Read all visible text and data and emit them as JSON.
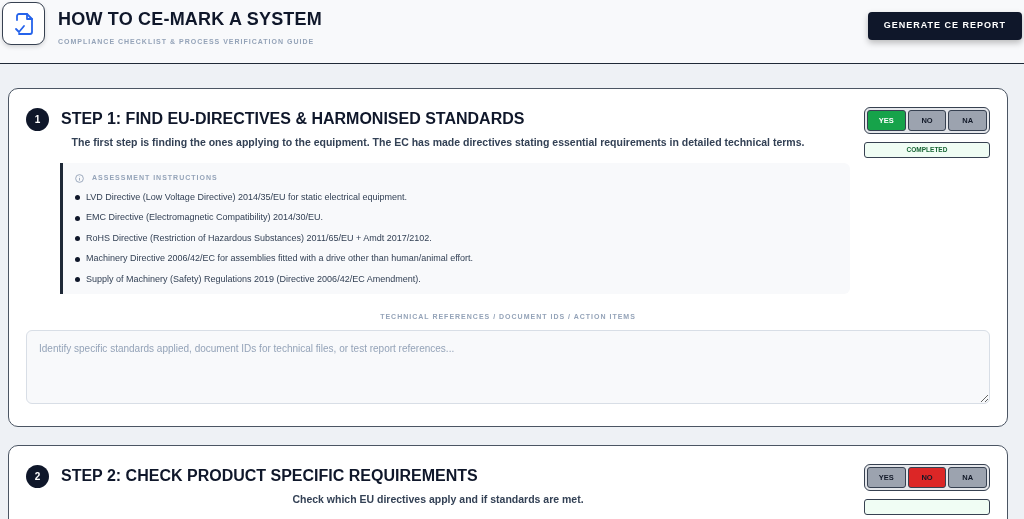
{
  "header": {
    "title": "HOW TO CE-MARK A SYSTEM",
    "subtitle": "COMPLIANCE CHECKLIST & PROCESS VERIFICATION GUIDE",
    "action": "GENERATE CE REPORT"
  },
  "steps": [
    {
      "number": "1",
      "title": "STEP 1: FIND EU-DIRECTIVES & HARMONISED STANDARDS",
      "description": "The first step is finding the ones applying to the equipment. The EC has made directives stating essential requirements in detailed technical terms.",
      "choices": [
        {
          "label": "YES",
          "selected": true
        },
        {
          "label": "NO",
          "selected": false
        },
        {
          "label": "NA",
          "selected": false
        }
      ],
      "status": {
        "label": "COMPLETED",
        "kind": "completed"
      },
      "instructions": {
        "heading": "ASSESSMENT INSTRUCTIONS",
        "items": [
          "LVD Directive (Low Voltage Directive) 2014/35/EU for static electrical equipment.",
          "EMC Directive (Electromagnetic Compatibility) 2014/30/EU.",
          "RoHS Directive (Restriction of Hazardous Substances) 2011/65/EU + Amdt 2017/2102.",
          "Machinery Directive 2006/42/EC for assemblies fitted with a drive other than human/animal effort.",
          "Supply of Machinery (Safety) Regulations 2019 (Directive 2006/42/EC Amendment)."
        ]
      },
      "notes": {
        "label": "TECHNICAL REFERENCES / DOCUMENT IDS / ACTION ITEMS",
        "placeholder": "Identify specific standards applied, document IDs for technical files, or test report references..."
      }
    },
    {
      "number": "2",
      "title": "STEP 2: CHECK PRODUCT SPECIFIC REQUIREMENTS",
      "description": "Check which EU directives apply and if standards are met.",
      "choices": [
        {
          "label": "YES",
          "selected": false
        },
        {
          "label": "NO",
          "selected": true
        },
        {
          "label": "NA",
          "selected": false
        }
      ],
      "status": {
        "kind": "completed"
      }
    }
  ]
}
